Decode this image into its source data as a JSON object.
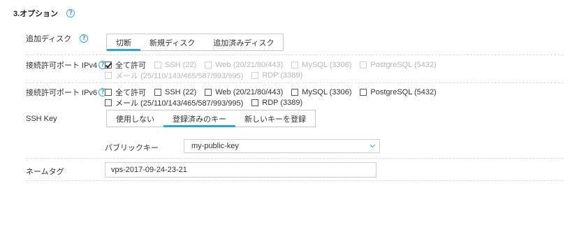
{
  "section": {
    "title": "3.オプション"
  },
  "icons": {
    "help": "question-circle-icon",
    "checkbox_checked": "checkbox-checked-icon",
    "checkbox": "checkbox-icon",
    "chevron": "chevron-down-icon"
  },
  "help_glyph": "?",
  "colors": {
    "accent": "#2fa4d6",
    "disabled_text": "#b8b8b8",
    "divider": "#dcdcdc"
  },
  "disk": {
    "label": "追加ディスク",
    "tabs": [
      {
        "label": "切断",
        "active": true
      },
      {
        "label": "新規ディスク",
        "active": false
      },
      {
        "label": "追加済みディスク",
        "active": false
      }
    ]
  },
  "ipv4": {
    "label": "接続許可ポート IPv4",
    "options": [
      {
        "label": "全て許可",
        "checked": true,
        "disabled": false
      },
      {
        "label": "SSH (22)",
        "checked": false,
        "disabled": true
      },
      {
        "label": "Web (20/21/80/443)",
        "checked": false,
        "disabled": true
      },
      {
        "label": "MySQL (3306)",
        "checked": false,
        "disabled": true
      },
      {
        "label": "PostgreSQL (5432)",
        "checked": false,
        "disabled": true
      },
      {
        "label": "メール (25/110/143/465/587/993/995)",
        "checked": false,
        "disabled": true
      },
      {
        "label": "RDP (3389)",
        "checked": false,
        "disabled": true
      }
    ]
  },
  "ipv6": {
    "label": "接続許可ポート IPv6",
    "options": [
      {
        "label": "全て許可",
        "checked": false,
        "disabled": false
      },
      {
        "label": "SSH (22)",
        "checked": false,
        "disabled": false
      },
      {
        "label": "Web (20/21/80/443)",
        "checked": false,
        "disabled": false
      },
      {
        "label": "MySQL (3306)",
        "checked": false,
        "disabled": false
      },
      {
        "label": "PostgreSQL (5432)",
        "checked": false,
        "disabled": false
      },
      {
        "label": "メール (25/110/143/465/587/993/995)",
        "checked": false,
        "disabled": false
      },
      {
        "label": "RDP (3389)",
        "checked": false,
        "disabled": false
      }
    ]
  },
  "ssh": {
    "label": "SSH Key",
    "tabs": [
      {
        "label": "使用しない",
        "active": false
      },
      {
        "label": "登録済みのキー",
        "active": true
      },
      {
        "label": "新しいキーを登録",
        "active": false
      }
    ],
    "public_key_label": "パブリックキー",
    "public_key_value": "my-public-key"
  },
  "name_tag": {
    "label": "ネームタグ",
    "value": "vps-2017-09-24-23-21"
  }
}
